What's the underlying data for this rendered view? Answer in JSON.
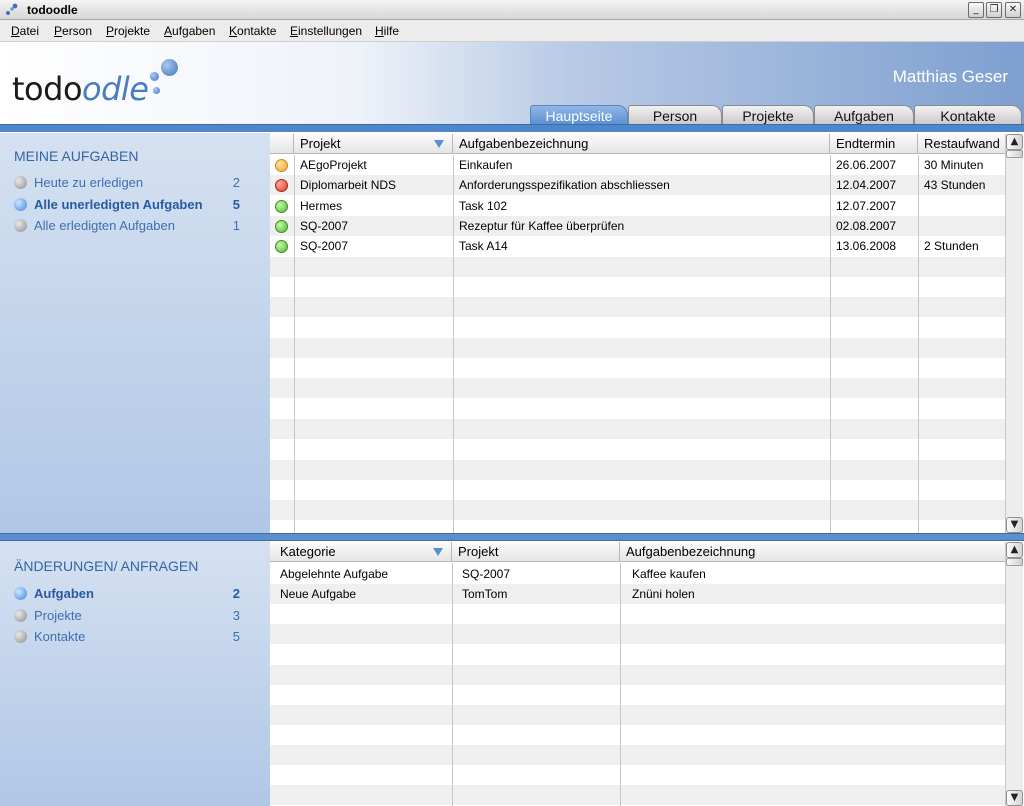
{
  "window": {
    "title": "todoodle"
  },
  "menu": [
    {
      "key": "D",
      "rest": "atei"
    },
    {
      "key": "P",
      "rest": "erson"
    },
    {
      "key": "P",
      "rest": "rojekte"
    },
    {
      "key": "A",
      "rest": "ufgaben"
    },
    {
      "key": "K",
      "rest": "ontakte"
    },
    {
      "key": "E",
      "rest": "instellungen"
    },
    {
      "key": "H",
      "rest": "ilfe"
    }
  ],
  "header": {
    "logo_part1": "todo",
    "logo_part2": "odle",
    "user": "Matthias Geser"
  },
  "tabs": [
    "Hauptseite",
    "Person",
    "Projekte",
    "Aufgaben",
    "Kontakte"
  ],
  "meine_aufgaben": {
    "title": "MEINE AUFGABEN",
    "items": [
      {
        "label": "Heute zu erledigen",
        "count": "2"
      },
      {
        "label": "Alle unerledigten Aufgaben",
        "count": "5"
      },
      {
        "label": "Alle erledigten Aufgaben",
        "count": "1"
      }
    ]
  },
  "aenderungen": {
    "title": "ÄNDERUNGEN/ ANFRAGEN",
    "items": [
      {
        "label": "Aufgaben",
        "count": "2"
      },
      {
        "label": "Projekte",
        "count": "3"
      },
      {
        "label": "Kontakte",
        "count": "5"
      }
    ]
  },
  "tasks_table": {
    "columns": [
      "Projekt",
      "Aufgabenbezeichnung",
      "Endtermin",
      "Restaufwand"
    ],
    "rows": [
      {
        "status": "orange",
        "projekt": "AEgoProjekt",
        "bezeichnung": "Einkaufen",
        "endtermin": "26.06.2007",
        "restaufwand": "30 Minuten"
      },
      {
        "status": "red",
        "projekt": "Diplomarbeit NDS",
        "bezeichnung": "Anforderungsspezifikation abschliessen",
        "endtermin": "12.04.2007",
        "restaufwand": "43 Stunden"
      },
      {
        "status": "green",
        "projekt": "Hermes",
        "bezeichnung": "Task 102",
        "endtermin": "12.07.2007",
        "restaufwand": ""
      },
      {
        "status": "green",
        "projekt": "SQ-2007",
        "bezeichnung": "Rezeptur für Kaffee überprüfen",
        "endtermin": "02.08.2007",
        "restaufwand": ""
      },
      {
        "status": "green",
        "projekt": "SQ-2007",
        "bezeichnung": "Task A14",
        "endtermin": "13.06.2008",
        "restaufwand": "2 Stunden"
      }
    ]
  },
  "changes_table": {
    "columns": [
      "Kategorie",
      "Projekt",
      "Aufgabenbezeichnung"
    ],
    "rows": [
      {
        "kategorie": "Abgelehnte Aufgabe",
        "projekt": "SQ-2007",
        "bezeichnung": "Kaffee kaufen"
      },
      {
        "kategorie": "Neue Aufgabe",
        "projekt": "TomTom",
        "bezeichnung": "Znüni holen"
      }
    ]
  },
  "colors": {
    "accent": "#4f86c9",
    "link": "#3f6fb0",
    "status_orange": "#f0a020",
    "status_red": "#e03020",
    "status_green": "#4fb830"
  }
}
